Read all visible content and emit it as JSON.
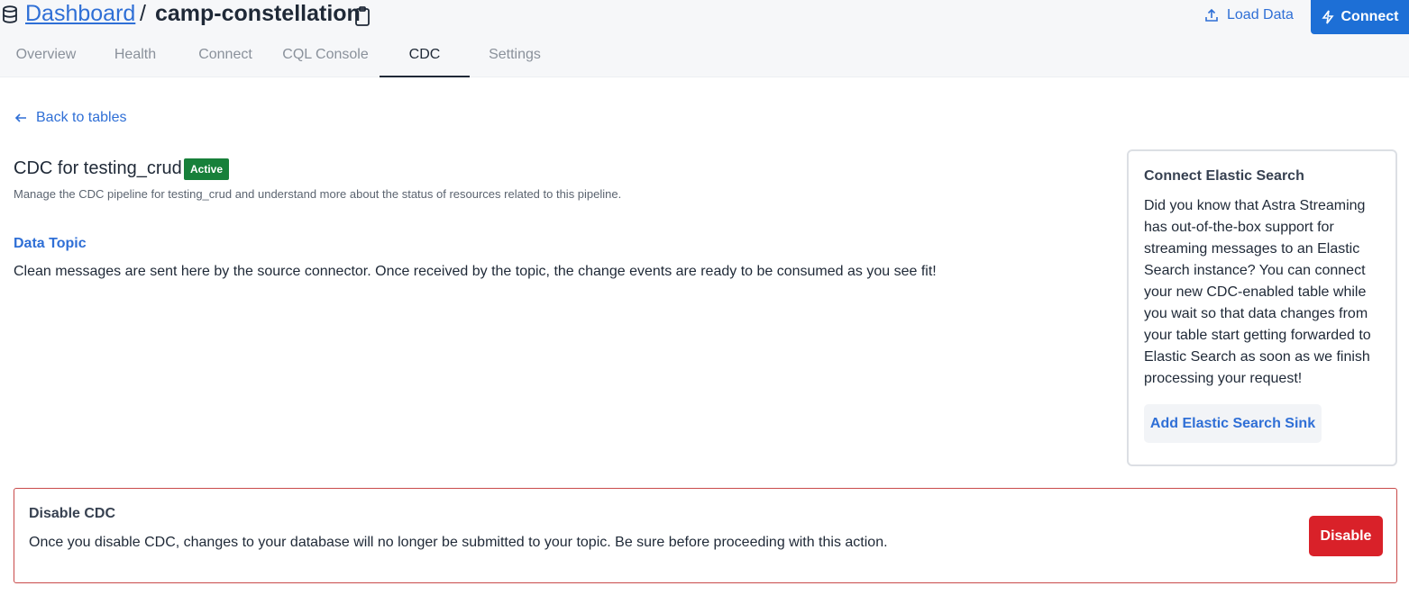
{
  "header": {
    "breadcrumb_link": "Dashboard",
    "separator": "/",
    "database_name": "camp-constellation",
    "load_data_label": "Load Data",
    "connect_label": "Connect"
  },
  "tabs": [
    {
      "label": "Overview",
      "active": false
    },
    {
      "label": "Health",
      "active": false
    },
    {
      "label": "Connect",
      "active": false
    },
    {
      "label": "CQL Console",
      "active": false
    },
    {
      "label": "CDC",
      "active": true
    },
    {
      "label": "Settings",
      "active": false
    }
  ],
  "back_link": "Back to tables",
  "cdc": {
    "title": "CDC for testing_crud",
    "status_badge": "Active",
    "description": "Manage the CDC pipeline for testing_crud and understand more about the status of resources related to this pipeline.",
    "data_topic_title": "Data Topic",
    "data_topic_body": "Clean messages are sent here by the source connector. Once received by the topic, the change events are ready to be consumed as you see fit!"
  },
  "elastic_card": {
    "title": "Connect Elastic Search",
    "body": "Did you know that Astra Streaming has out-of-the-box support for streaming messages to an Elastic Search instance? You can connect your new CDC-enabled table while you wait so that data changes from your table start getting forwarded to Elastic Search as soon as we finish processing your request!",
    "button_label": "Add Elastic Search Sink"
  },
  "disable_section": {
    "title": "Disable CDC",
    "body": "Once you disable CDC, changes to your database will no longer be submitted to your topic. Be sure before proceeding with this action.",
    "button_label": "Disable"
  },
  "colors": {
    "accent": "#2f6fd6",
    "primary_button": "#1d6fd6",
    "active_badge": "#17803a",
    "danger": "#d92129",
    "danger_border": "#c94a4a"
  },
  "icons": {
    "database": "database-icon",
    "clipboard": "clipboard-icon",
    "upload": "upload-icon",
    "lightning": "lightning-icon",
    "back_arrow": "arrow-left-icon"
  }
}
